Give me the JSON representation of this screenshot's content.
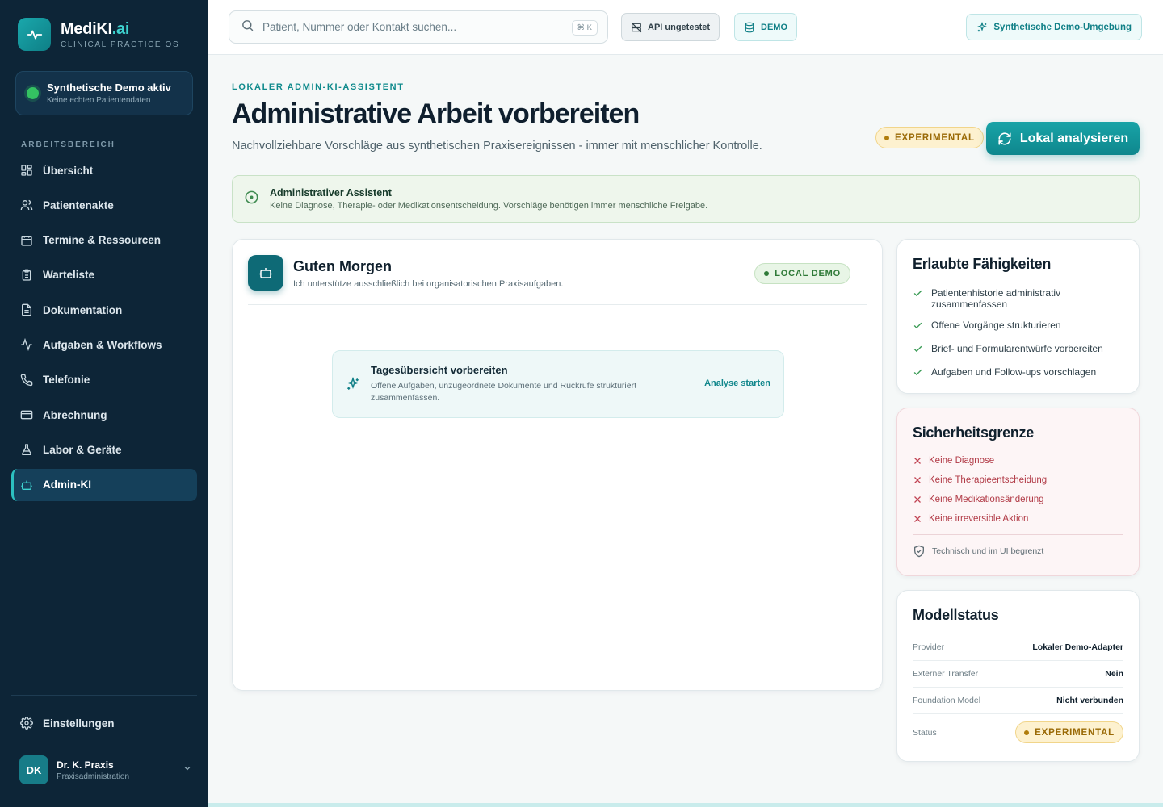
{
  "brand": {
    "name": "MediKI",
    "suffix": ".ai",
    "tagline": "CLINICAL PRACTICE OS"
  },
  "demo_status": {
    "title": "Synthetische Demo aktiv",
    "subtitle": "Keine echten Patientendaten"
  },
  "sidebar": {
    "section_label": "ARBEITSBEREICH",
    "items": [
      {
        "label": "Übersicht",
        "icon": "dashboard-icon"
      },
      {
        "label": "Patientenakte",
        "icon": "users-icon"
      },
      {
        "label": "Termine & Ressourcen",
        "icon": "calendar-icon"
      },
      {
        "label": "Warteliste",
        "icon": "clipboard-icon"
      },
      {
        "label": "Dokumentation",
        "icon": "document-icon"
      },
      {
        "label": "Aufgaben & Workflows",
        "icon": "activity-icon"
      },
      {
        "label": "Telefonie",
        "icon": "phone-icon"
      },
      {
        "label": "Abrechnung",
        "icon": "credit-card-icon"
      },
      {
        "label": "Labor & Geräte",
        "icon": "flask-icon"
      },
      {
        "label": "Admin-KI",
        "icon": "bot-icon",
        "active": true
      }
    ],
    "settings_label": "Einstellungen",
    "user": {
      "initials": "DK",
      "name": "Dr. K. Praxis",
      "role": "Praxisadministration"
    }
  },
  "topbar": {
    "search_placeholder": "Patient, Nummer oder Kontakt suchen...",
    "search_shortcut": "⌘ K",
    "api_status": "API ungetestet",
    "demo_label": "DEMO",
    "env_label": "Synthetische Demo-Umgebung"
  },
  "header": {
    "eyebrow": "LOKALER ADMIN-KI-ASSISTENT",
    "title": "Administrative Arbeit vorbereiten",
    "subtitle": "Nachvollziehbare Vorschläge aus synthetischen Praxisereignissen - immer mit menschlicher Kontrolle.",
    "badge": "EXPERIMENTAL",
    "analyze_button": "Lokal analysieren"
  },
  "notice": {
    "title": "Administrativer Assistent",
    "text": "Keine Diagnose, Therapie- oder Medikationsentscheidung. Vorschläge benötigen immer menschliche Freigabe."
  },
  "chat": {
    "greeting": "Guten Morgen",
    "subtitle": "Ich unterstütze ausschließlich bei organisatorischen Praxisaufgaben.",
    "badge": "LOCAL DEMO",
    "suggestion": {
      "title": "Tagesübersicht vorbereiten",
      "text": "Offene Aufgaben, unzugeordnete Dokumente und Rückrufe strukturiert zusammenfassen.",
      "action": "Analyse starten"
    }
  },
  "capabilities": {
    "title": "Erlaubte Fähigkeiten",
    "items": [
      "Patientenhistorie administrativ zusammenfassen",
      "Offene Vorgänge strukturieren",
      "Brief- und Formularentwürfe vorbereiten",
      "Aufgaben und Follow-ups vorschlagen"
    ]
  },
  "safety": {
    "title": "Sicherheitsgrenze",
    "items": [
      "Keine Diagnose",
      "Keine Therapieentscheidung",
      "Keine Medikationsänderung",
      "Keine irreversible Aktion"
    ],
    "footer": "Technisch und im UI begrenzt"
  },
  "model_status": {
    "title": "Modellstatus",
    "rows": [
      {
        "key": "Provider",
        "value": "Lokaler Demo-Adapter"
      },
      {
        "key": "Externer Transfer",
        "value": "Nein"
      },
      {
        "key": "Foundation Model",
        "value": "Nicht verbunden"
      },
      {
        "key": "Status",
        "value": "EXPERIMENTAL"
      }
    ]
  },
  "colors": {
    "sidebar_bg": "#0d2537",
    "accent": "#0f878d",
    "warning": "#9a6a07",
    "danger": "#b13a46",
    "success": "#2f7a38"
  }
}
